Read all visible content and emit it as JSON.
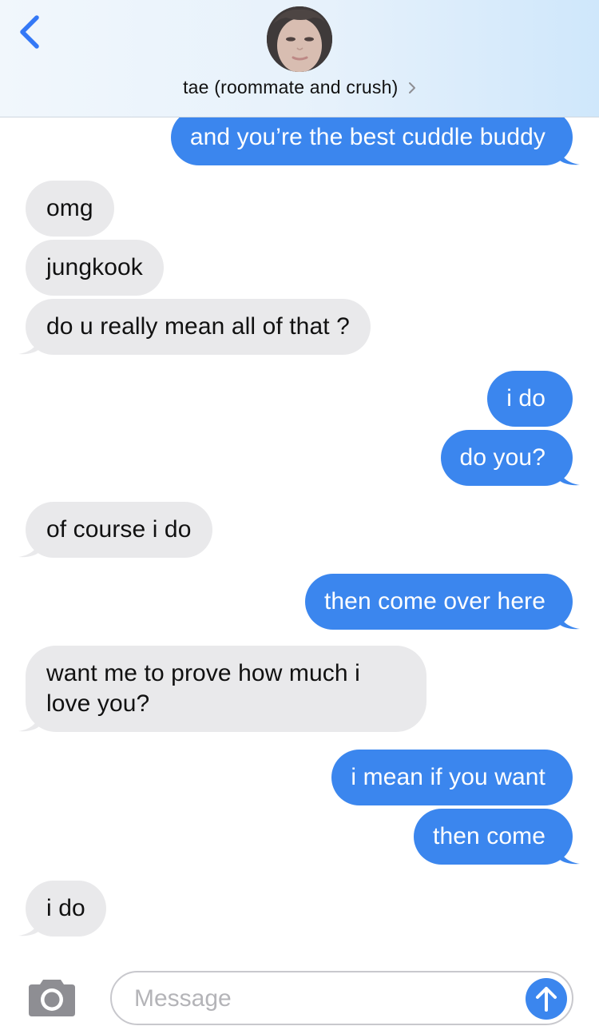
{
  "header": {
    "contact_name": "tae (roommate and crush)",
    "back_icon": "chevron-left-icon",
    "detail_icon": "chevron-right-icon",
    "avatar": "contact-avatar-photo"
  },
  "colors": {
    "sent_bubble": "#3b86ee",
    "received_bubble": "#e9e9eb",
    "accent": "#3478f6",
    "header_tint": "#d6ebfb"
  },
  "messages": [
    {
      "direction": "sent",
      "text": "and you’re the best cuddle buddy"
    },
    {
      "direction": "received",
      "text": "omg"
    },
    {
      "direction": "received",
      "text": "jungkook"
    },
    {
      "direction": "received",
      "text": "do u really mean all of that ?"
    },
    {
      "direction": "sent",
      "text": "i do"
    },
    {
      "direction": "sent",
      "text": "do you?"
    },
    {
      "direction": "received",
      "text": "of course i do"
    },
    {
      "direction": "sent",
      "text": "then come over here"
    },
    {
      "direction": "received",
      "text": "want me to prove how much i love you?"
    },
    {
      "direction": "sent",
      "text": "i mean if you want"
    },
    {
      "direction": "sent",
      "text": "then come"
    },
    {
      "direction": "received",
      "text": "i do"
    }
  ],
  "composer": {
    "placeholder": "Message",
    "camera_icon": "camera-icon",
    "send_icon": "arrow-up-icon"
  }
}
